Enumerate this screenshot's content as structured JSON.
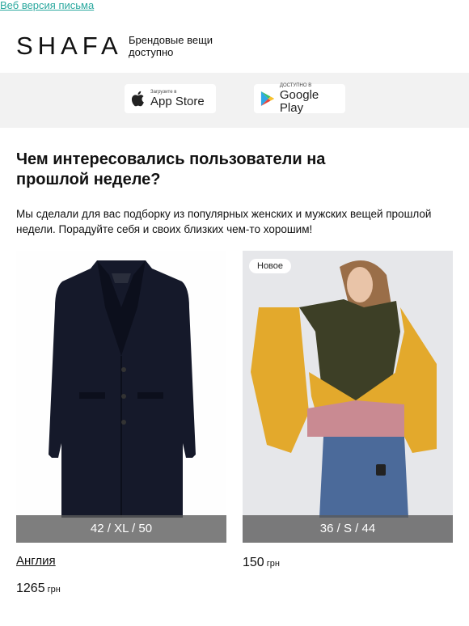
{
  "header": {
    "web_version_link": "Веб версия письма",
    "logo": "SHAFA",
    "tagline": "Брендовые вещи доступно"
  },
  "stores": {
    "app_store": {
      "small": "Загрузите в",
      "big": "App Store"
    },
    "google_play": {
      "small": "ДОСТУПНО В",
      "big": "Google Play"
    }
  },
  "main": {
    "title": "Чем интересовались пользователи на прошлой неделе?",
    "intro": "Мы сделали для вас подборку из популярных женских и мужских вещей прошлой недели. Порадуйте себя и своих близких чем-то хорошим!"
  },
  "products": [
    {
      "sizes": "42 / XL / 50",
      "brand": "Англия",
      "price": "1265",
      "currency": "грн"
    },
    {
      "badge": "Новое",
      "sizes": "36 / S / 44",
      "price": "150",
      "currency": "грн"
    }
  ],
  "colors": {
    "link": "#2aa89e",
    "store_band": "#f2f2f2"
  }
}
